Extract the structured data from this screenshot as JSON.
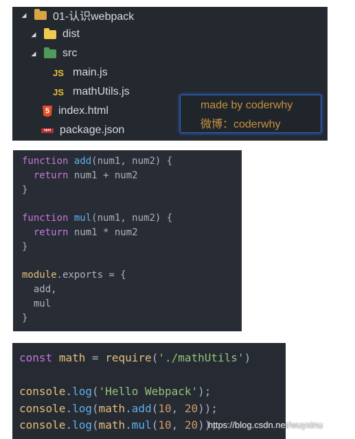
{
  "file_tree": {
    "items": [
      {
        "label": "01-认识webpack",
        "icon": "folder-open-icon",
        "color": "#d9a441"
      },
      {
        "label": "dist",
        "icon": "folder-open-icon",
        "color": "#f0c94e"
      },
      {
        "label": "src",
        "icon": "folder-src-icon",
        "color": "#4e9a5b"
      },
      {
        "label": "main.js",
        "icon": "js-file-icon"
      },
      {
        "label": "mathUtils.js",
        "icon": "js-file-icon"
      },
      {
        "label": "index.html",
        "icon": "html5-file-icon"
      },
      {
        "label": "package.json",
        "icon": "npm-file-icon"
      }
    ],
    "js_icon_text": "JS",
    "html_icon_text": "5",
    "npm_icon_text": "npm"
  },
  "badge": {
    "line1": "made by coderwhy",
    "line2": "微博：coderwhy"
  },
  "math_utils_code": {
    "lines": [
      "function add(num1, num2) {",
      "  return num1 + num2",
      "}",
      "",
      "function mul(num1, num2) {",
      "  return num1 * num2",
      "}",
      "",
      "module.exports = {",
      "  add,",
      "  mul",
      "}"
    ]
  },
  "main_code": {
    "lines": [
      "const math = require('./mathUtils')",
      "",
      "console.log('Hello Webpack');",
      "console.log(math.add(10, 20));",
      "console.log(math.mul(10, 20));"
    ]
  },
  "watermark": "https://blog.csdn.net/wuyxinu",
  "colors": {
    "keyword": "#c678dd",
    "function": "#61afef",
    "string": "#98c379",
    "number": "#d19a66",
    "object": "#e5c07b"
  }
}
